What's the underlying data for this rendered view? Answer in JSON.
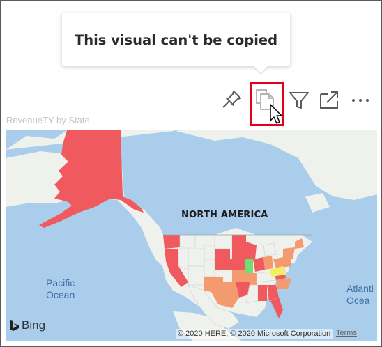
{
  "tooltip": {
    "text": "This visual can't be copied"
  },
  "toolbar": {
    "icons": [
      "pin-icon",
      "copy-icon",
      "filter-icon",
      "focus-mode-icon",
      "more-options-icon"
    ]
  },
  "visual": {
    "title": "RevenueTY by State"
  },
  "map": {
    "region_label": "NORTH AMERICA",
    "ocean_pacific": "Pacific\nOcean",
    "ocean_atlantic": "Atlanti\nOcea",
    "attribution_logo": "Bing",
    "copyright": "© 2020 HERE, © 2020 Microsoft Corporation",
    "terms": "Terms"
  },
  "colors": {
    "highlight": "#e3001b",
    "state_red": "#f0595d",
    "state_orange": "#f39a6e",
    "state_green": "#6fe06f",
    "state_yellow": "#f3ee62",
    "water": "#a9cdea",
    "land": "#eef1ec"
  }
}
